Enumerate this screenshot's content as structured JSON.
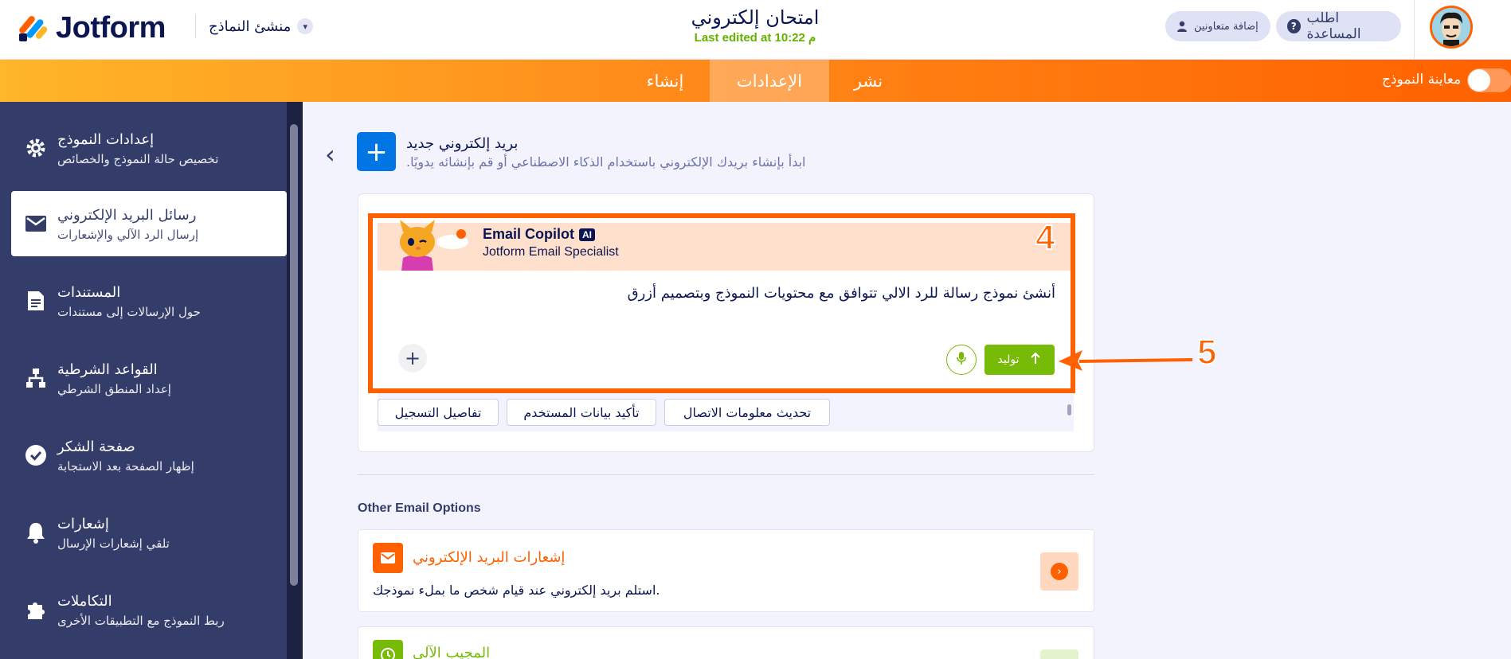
{
  "header": {
    "logo_text": "Jotform",
    "form_builder_label": "منشئ النماذج",
    "form_title": "امتحان إلكتروني",
    "last_edited": "Last edited at 10:22 م",
    "collaborators_label": "إضافة متعاونين",
    "help_label": "اطلب المساعدة"
  },
  "nav": {
    "tabs": [
      {
        "label": "إنشاء"
      },
      {
        "label": "الإعدادات",
        "active": true
      },
      {
        "label": "نشر"
      }
    ],
    "preview_label": "معاينة النموذج",
    "preview_toggle_on": false
  },
  "sidebar": {
    "items": [
      {
        "title": "إعدادات النموذج",
        "subtitle": "تخصيص حالة النموذج والخصائص",
        "icon": "gear-icon"
      },
      {
        "title": "رسائل البريد الإلكتروني",
        "subtitle": "إرسال الرد الآلي والإشعارات",
        "icon": "envelope-icon",
        "active": true
      },
      {
        "title": "المستندات",
        "subtitle": "حول الإرسالات إلى مستندات",
        "icon": "document-icon"
      },
      {
        "title": "القواعد الشرطية",
        "subtitle": "إعداد المنطق الشرطي",
        "icon": "flow-icon"
      },
      {
        "title": "صفحة الشكر",
        "subtitle": "إظهار الصفحة بعد الاستجابة",
        "icon": "check-circle-icon"
      },
      {
        "title": "إشعارات",
        "subtitle": "تلقي إشعارات الإرسال",
        "icon": "bell-icon"
      },
      {
        "title": "التكاملات",
        "subtitle": "ربط النموذج مع التطبيقات الأخرى",
        "icon": "puzzle-icon"
      }
    ]
  },
  "main": {
    "new_email_title": "بريد إلكتروني جديد",
    "new_email_subtitle": ".ابدأ بإنشاء بريدك الإلكتروني باستخدام الذكاء الاصطناعي أو قم بإنشائه يدويًا",
    "copilot": {
      "name": "Email Copilot",
      "ai_badge": "AI",
      "role": "Jotform Email Specialist",
      "prompt": "أنشئ نموذج رسالة للرد الالي تتوافق مع محتويات النموذج وبتصميم أزرق",
      "generate_label": "توليد",
      "chips": [
        "تحديث معلومات الاتصال",
        "تأكيد بيانات المستخدم",
        "تفاصيل التسجيل"
      ]
    },
    "annotations": {
      "marker_4": "4",
      "marker_5": "5"
    },
    "other_options_title": "Other Email Options",
    "options": [
      {
        "title": "إشعارات البريد الإلكتروني",
        "description": ".استلم بريد إلكتروني عند قيام شخص ما بملء نموذجك",
        "color": "#ff6100"
      },
      {
        "title": "المجيب الآلي",
        "description": "",
        "color": "#78bb07"
      }
    ]
  },
  "colors": {
    "brand_orange": "#ff6100",
    "sidebar_bg": "#343c6a",
    "primary_blue": "#0075e3",
    "generate_green": "#78bb07",
    "text_navy": "#0a1551"
  }
}
